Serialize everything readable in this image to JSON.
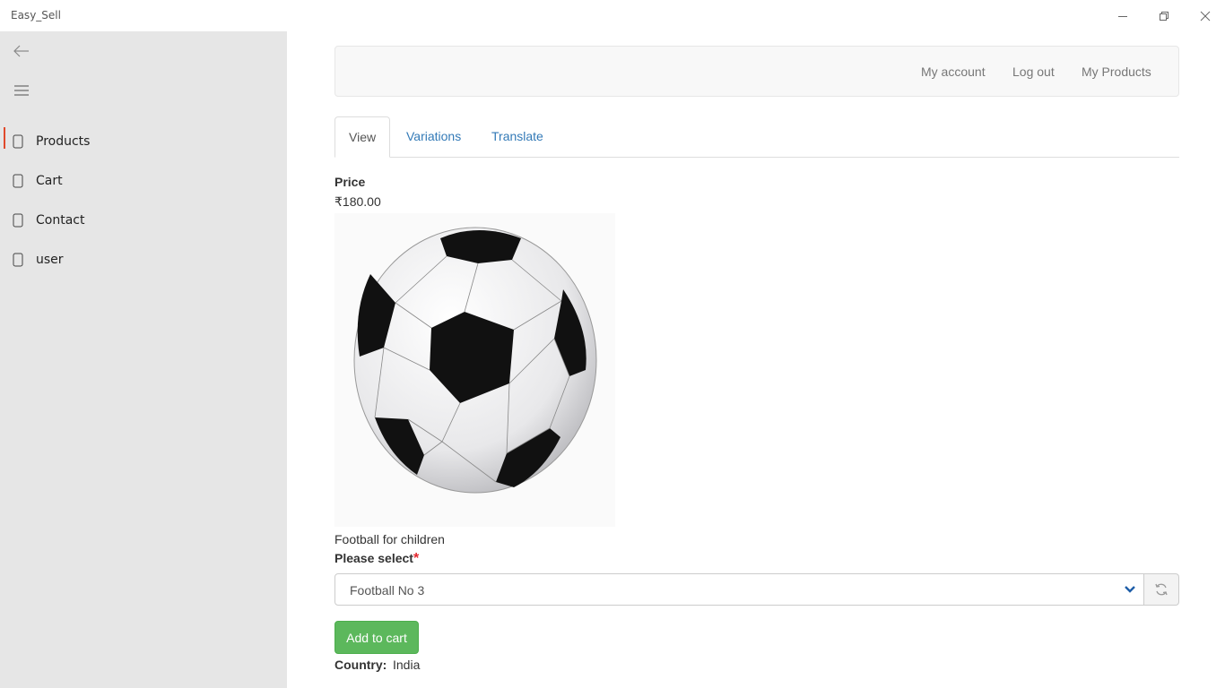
{
  "window": {
    "title": "Easy_Sell",
    "minimize_icon": "minimize-icon",
    "maximize_icon": "restore-icon",
    "close_icon": "close-icon"
  },
  "sidebar": {
    "back_icon": "back-arrow-icon",
    "menu_icon": "hamburger-menu-icon",
    "items": [
      {
        "label": "Products",
        "icon": "phone-outline-icon",
        "active": true
      },
      {
        "label": "Cart",
        "icon": "phone-outline-icon",
        "active": false
      },
      {
        "label": "Contact",
        "icon": "phone-outline-icon",
        "active": false
      },
      {
        "label": "user",
        "icon": "phone-outline-icon",
        "active": false
      }
    ],
    "active_color": "#e04a2c"
  },
  "header": {
    "links": [
      "My account",
      "Log out",
      "My Products"
    ]
  },
  "tabs": [
    {
      "label": "View",
      "active": true
    },
    {
      "label": "Variations",
      "active": false
    },
    {
      "label": "Translate",
      "active": false
    }
  ],
  "product": {
    "price_label": "Price",
    "price_value": "₹180.00",
    "image": "football-image",
    "description": "Football for children",
    "select_label": "Please select",
    "required_mark": "*",
    "selected_option": "Football No 3",
    "add_to_cart_label": "Add to cart",
    "country_label": "Country:",
    "country_value": "India"
  },
  "colors": {
    "link": "#337ab7",
    "add_button": "#5cb85c",
    "required": "#e3262d",
    "sidebar_bg": "#e6e6e6"
  }
}
